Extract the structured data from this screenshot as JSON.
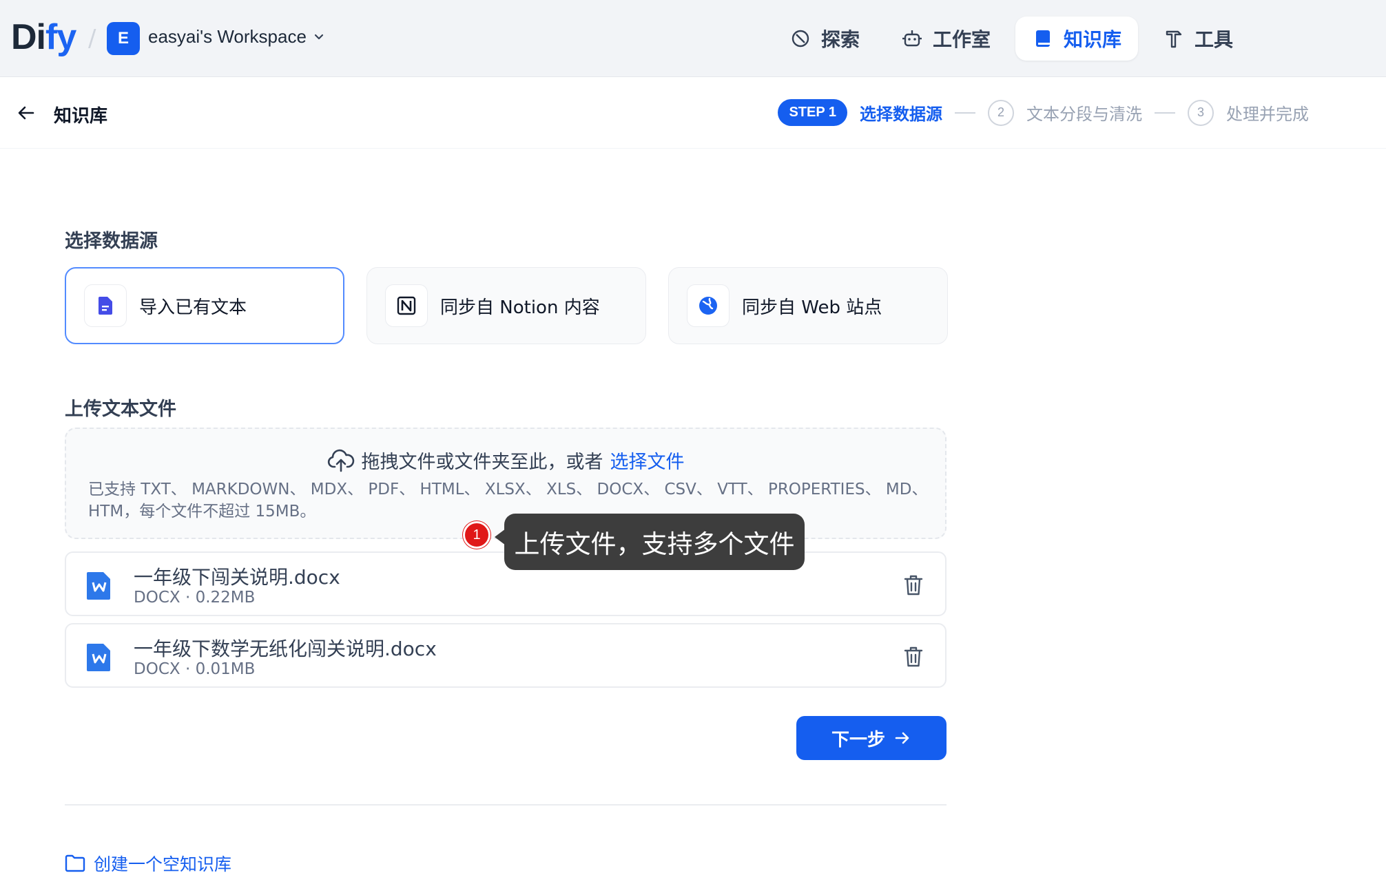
{
  "app": {
    "logo_main": "Di",
    "logo_accent": "fy",
    "workspace_initial": "E",
    "workspace_name": "easyai's Workspace"
  },
  "nav": [
    {
      "label": "探索",
      "icon": "compass-icon"
    },
    {
      "label": "工作室",
      "icon": "robot-icon"
    },
    {
      "label": "知识库",
      "icon": "book-icon",
      "active": true
    },
    {
      "label": "工具",
      "icon": "hammer-icon"
    }
  ],
  "subheader": {
    "title": "知识库",
    "steps": {
      "step1_pill": "STEP 1",
      "step1_label": "选择数据源",
      "step2_num": "2",
      "step2_label": "文本分段与清洗",
      "step3_num": "3",
      "step3_label": "处理并完成"
    }
  },
  "datasource": {
    "title": "选择数据源",
    "options": [
      {
        "label": "导入已有文本",
        "icon": "document-icon",
        "selected": true
      },
      {
        "label": "同步自 Notion 内容",
        "icon": "notion-icon"
      },
      {
        "label": "同步自 Web 站点",
        "icon": "globe-icon"
      }
    ]
  },
  "upload": {
    "title": "上传文本文件",
    "prompt": "拖拽文件或文件夹至此，或者",
    "select_link": "选择文件",
    "supported": "已支持 TXT、 MARKDOWN、 MDX、 PDF、 HTML、 XLSX、 XLS、 DOCX、 CSV、 VTT、 PROPERTIES、 MD、 HTM，每个文件不超过 15MB。",
    "files": [
      {
        "name": "一年级下闯关说明.docx",
        "meta": "DOCX · 0.22MB"
      },
      {
        "name": "一年级下数学无纸化闯关说明.docx",
        "meta": "DOCX · 0.01MB"
      }
    ]
  },
  "tooltip": {
    "badge": "1",
    "text": "上传文件，支持多个文件"
  },
  "actions": {
    "next": "下一步",
    "create_empty": "创建一个空知识库"
  },
  "colors": {
    "primary": "#155eef",
    "header_bg": "#f2f4f7",
    "badge_red": "#e01818"
  }
}
